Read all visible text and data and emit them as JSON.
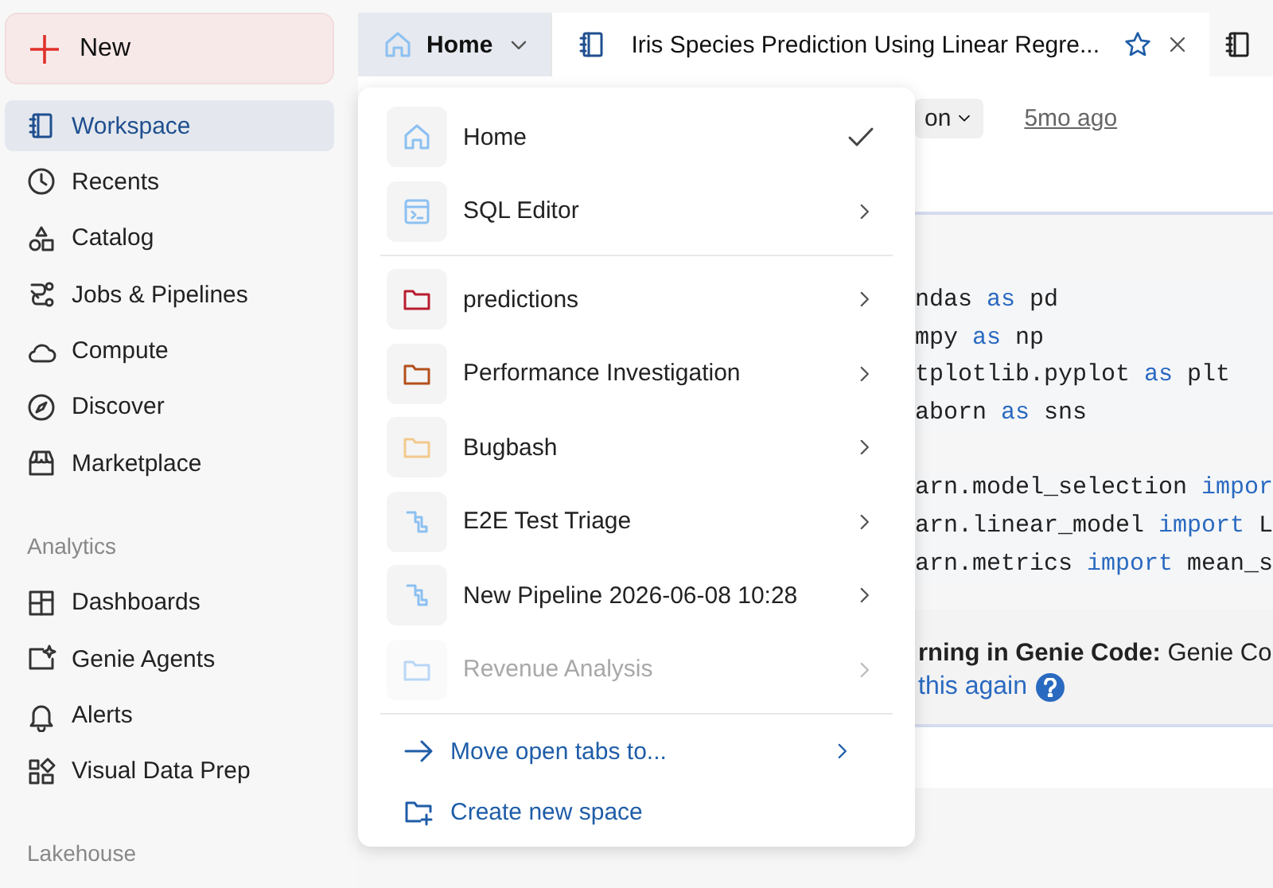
{
  "sidebar": {
    "new_button": "New",
    "items": [
      {
        "label": "Workspace",
        "selected": true
      },
      {
        "label": "Recents",
        "selected": false
      },
      {
        "label": "Catalog",
        "selected": false
      },
      {
        "label": "Jobs & Pipelines",
        "selected": false
      },
      {
        "label": "Compute",
        "selected": false
      },
      {
        "label": "Discover",
        "selected": false
      },
      {
        "label": "Marketplace",
        "selected": false
      }
    ],
    "sections": [
      {
        "title": "Analytics",
        "items": [
          {
            "label": "Dashboards",
            "selected": false
          },
          {
            "label": "Genie Agents",
            "selected": false
          },
          {
            "label": "Alerts",
            "selected": false
          },
          {
            "label": "Visual Data Prep",
            "selected": false
          }
        ]
      },
      {
        "title": "Lakehouse"
      }
    ]
  },
  "tabs": [
    {
      "kind": "space",
      "label": "Home",
      "selected": false
    },
    {
      "kind": "notebook",
      "label": "Iris Species Prediction Using Linear Regre...",
      "selected": true,
      "starred": true
    },
    {
      "kind": "notebook",
      "selected": false
    }
  ],
  "notebook": {
    "language_chip": "on",
    "edited": "5mo ago",
    "code_blocks": [
      [
        [
          {
            "t": "ndas ",
            "kind": "name"
          },
          {
            "t": "as",
            "kind": "keyword"
          },
          {
            "t": " pd",
            "kind": "name"
          }
        ],
        [
          {
            "t": "mpy ",
            "kind": "name"
          },
          {
            "t": "as",
            "kind": "keyword"
          },
          {
            "t": " np",
            "kind": "name"
          }
        ],
        [
          {
            "t": "tplotlib.pyplot ",
            "kind": "name"
          },
          {
            "t": "as",
            "kind": "keyword"
          },
          {
            "t": " plt",
            "kind": "name"
          }
        ],
        [
          {
            "t": "aborn ",
            "kind": "name"
          },
          {
            "t": "as",
            "kind": "keyword"
          },
          {
            "t": " sns",
            "kind": "name"
          }
        ]
      ],
      [
        [
          {
            "t": "arn.model_selection ",
            "kind": "name"
          },
          {
            "t": "impor",
            "kind": "keyword"
          }
        ],
        [
          {
            "t": "arn.linear_model ",
            "kind": "name"
          },
          {
            "t": "import",
            "kind": "keyword"
          },
          {
            "t": " L",
            "kind": "name"
          }
        ],
        [
          {
            "t": "arn.metrics ",
            "kind": "name"
          },
          {
            "t": "import",
            "kind": "keyword"
          },
          {
            "t": " mean_s",
            "kind": "name"
          }
        ]
      ]
    ],
    "warning": "**rning in Genie Code:** Genie Co",
    "warning_link": "this again"
  },
  "menu": {
    "items": [
      {
        "kind": "home",
        "label": "Home",
        "selected": true
      },
      {
        "kind": "sql",
        "label": "SQL Editor",
        "selected": false
      },
      {
        "kind": "separator"
      },
      {
        "kind": "folder",
        "label": "predictions",
        "color": "#b81d2e",
        "selected": false
      },
      {
        "kind": "folder",
        "label": "Performance Investigation",
        "color": "#b4501c",
        "selected": false
      },
      {
        "kind": "folder",
        "label": "Bugbash",
        "color": "#f2c98c",
        "selected": false
      },
      {
        "kind": "pipeline",
        "label": "E2E Test Triage",
        "selected": false
      },
      {
        "kind": "pipeline",
        "label": "New Pipeline 2026-06-08 10:28",
        "selected": false
      },
      {
        "kind": "folder",
        "label": "Revenue Analysis",
        "color": "#b9d6f5",
        "selected": false
      }
    ],
    "actions": [
      {
        "kind": "move",
        "label": "Move open tabs to..."
      },
      {
        "kind": "create",
        "label": "Create new space"
      }
    ]
  }
}
